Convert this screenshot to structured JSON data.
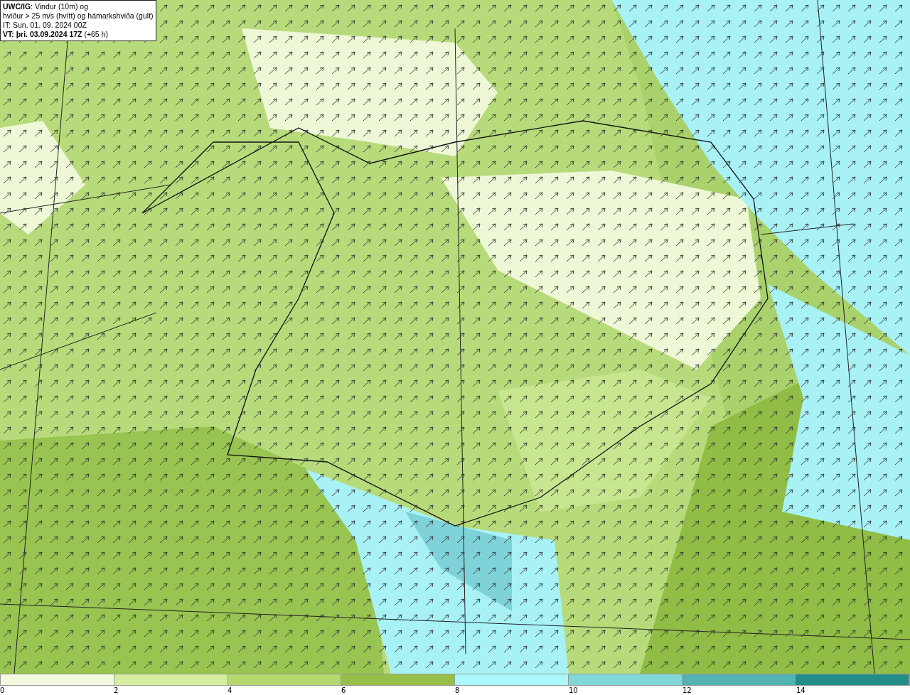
{
  "info_box": {
    "lines": [
      "**UWC/IG**: Vindur (10m) og",
      "hviður > 25 m/s (hvítt) og hámarkshviða (gult)",
      "IT: Sun. 01. 09. 2024 00Z",
      "**VT: þri. 03.09.2024 17Z** (+65 h)"
    ]
  },
  "legend": {
    "bins": [
      {
        "color": "#f4fadf"
      },
      {
        "color": "#d6ef9f"
      },
      {
        "color": "#b5d96f"
      },
      {
        "color": "#95bf48"
      },
      {
        "color": "#aaf8fa"
      },
      {
        "color": "#80d8d8"
      },
      {
        "color": "#52b2b2"
      },
      {
        "color": "#228c88"
      }
    ],
    "ticks": [
      "0",
      "2",
      "4",
      "6",
      "8",
      "10",
      "12",
      "14"
    ]
  }
}
